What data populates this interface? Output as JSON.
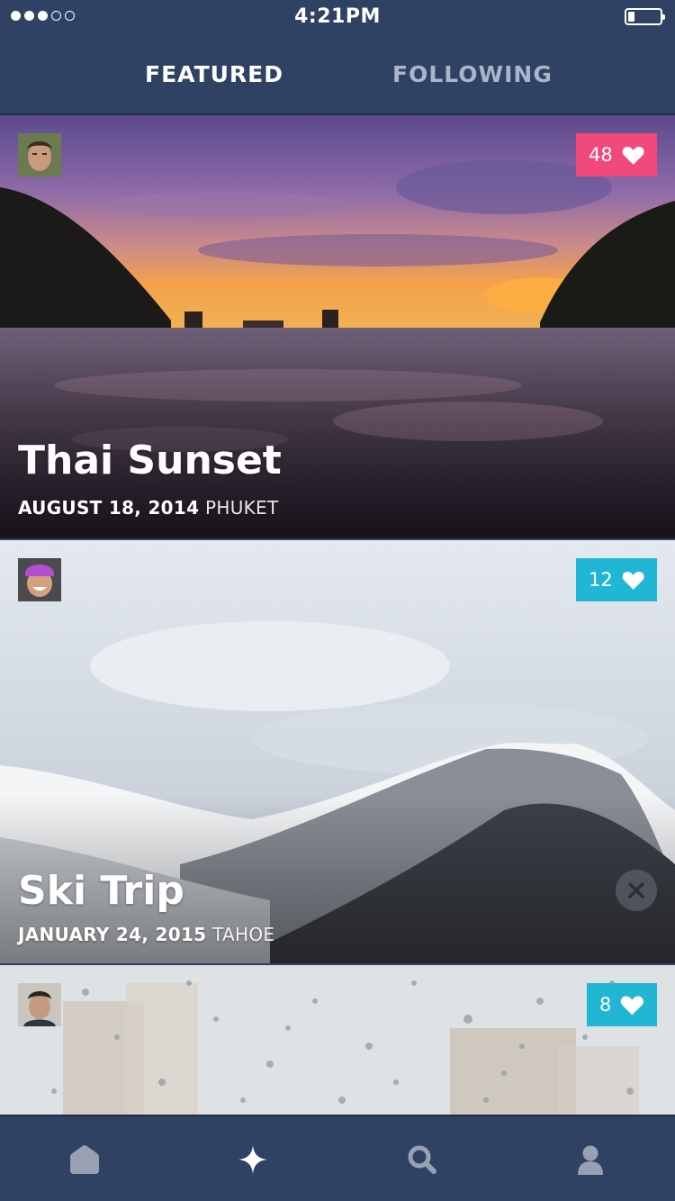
{
  "status_bar": {
    "time": "4:21PM",
    "signal_bars_filled": 3,
    "signal_bars_total": 5,
    "battery_level": 0.2
  },
  "tabs": [
    {
      "label": "FEATURED",
      "active": true
    },
    {
      "label": "FOLLOWING",
      "active": false
    }
  ],
  "cards": [
    {
      "title": "Thai Sunset",
      "date": "AUGUST 18, 2014",
      "location": "PHUKET",
      "likes": "48",
      "badge_color": "#f1497c",
      "avatar_icon": "user-avatar-icon"
    },
    {
      "title": "Ski Trip",
      "date": "JANUARY 24, 2015",
      "location": "TAHOE",
      "likes": "12",
      "badge_color": "#21b6d3",
      "avatar_icon": "user-avatar-icon"
    },
    {
      "title": "",
      "date": "",
      "location": "",
      "likes": "8",
      "badge_color": "#21b6d3",
      "avatar_icon": "user-avatar-icon"
    }
  ],
  "bottom_nav": [
    {
      "icon": "home-icon",
      "active": false
    },
    {
      "icon": "sparkle-icon",
      "active": true
    },
    {
      "icon": "search-icon",
      "active": false
    },
    {
      "icon": "profile-icon",
      "active": false
    }
  ],
  "colors": {
    "background": "#2f4263",
    "tab_active": "#ffffff",
    "tab_inactive": "#a9b5c9",
    "badge_pink": "#f1497c",
    "badge_cyan": "#21b6d3",
    "nav_inactive": "#97a1b3"
  }
}
